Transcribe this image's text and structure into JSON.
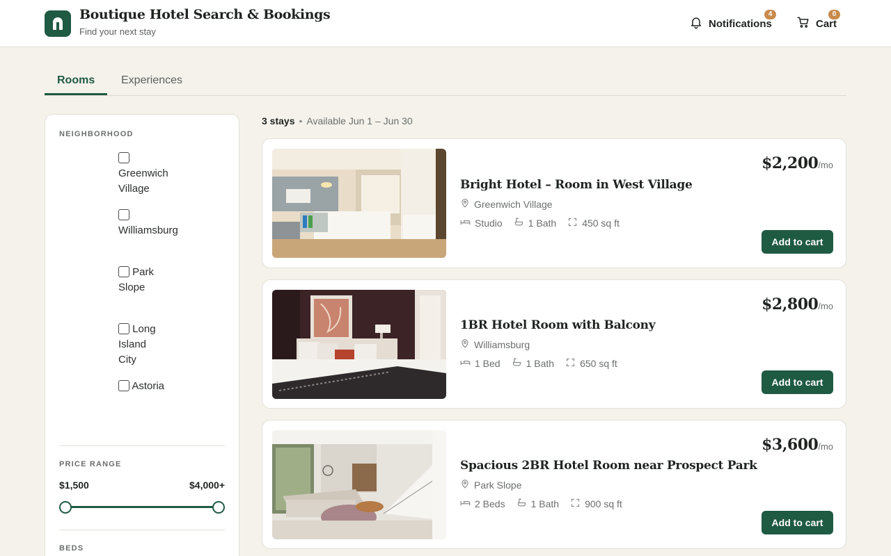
{
  "header": {
    "title": "Boutique Hotel Search & Bookings",
    "subtitle": "Find your next stay",
    "notifications_label": "Notifications",
    "notifications_count": "4",
    "cart_label": "Cart",
    "cart_count": "0"
  },
  "tabs": [
    {
      "label": "Rooms",
      "active": true
    },
    {
      "label": "Experiences",
      "active": false
    }
  ],
  "filters": {
    "neighborhood_title": "NEIGHBORHOOD",
    "neighborhoods": [
      {
        "label": "Greenwich Village",
        "checked": false
      },
      {
        "label": "Williamsburg",
        "checked": false
      },
      {
        "label": "Park Slope",
        "checked": false
      },
      {
        "label": "Long Island City",
        "checked": false
      },
      {
        "label": "Astoria",
        "checked": false
      }
    ],
    "price_title": "PRICE RANGE",
    "price_min": "$1,500",
    "price_max": "$4,000+",
    "beds_title": "BEDS"
  },
  "results": {
    "count": "3 stays",
    "availability": "Available Jun 1 – Jun 30",
    "listings": [
      {
        "title": "Bright Hotel – Room in West Village",
        "location": "Greenwich Village",
        "beds": "Studio",
        "baths": "1 Bath",
        "area": "450 sq ft",
        "price": "$2,200",
        "period": "/mo",
        "button": "Add to cart"
      },
      {
        "title": "1BR Hotel Room with Balcony",
        "location": "Williamsburg",
        "beds": "1 Bed",
        "baths": "1 Bath",
        "area": "650 sq ft",
        "price": "$2,800",
        "period": "/mo",
        "button": "Add to cart"
      },
      {
        "title": "Spacious 2BR Hotel Room near Prospect Park",
        "location": "Park Slope",
        "beds": "2 Beds",
        "baths": "1 Bath",
        "area": "900 sq ft",
        "price": "$3,600",
        "period": "/mo",
        "button": "Add to cart"
      }
    ]
  },
  "colors": {
    "brand": "#1f5a43",
    "badge": "#c98a4b",
    "background": "#f5f2ec"
  },
  "icons": {
    "notifications": "bell-icon",
    "cart": "cart-icon",
    "location": "map-pin-icon",
    "beds": "bed-icon",
    "baths": "bathtub-icon",
    "area": "expand-icon"
  }
}
